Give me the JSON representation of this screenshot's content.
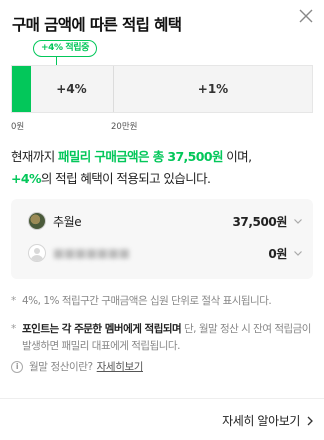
{
  "header": {
    "title": "구매 금액에 따른 적립 혜택",
    "close_icon": "close-icon"
  },
  "tier": {
    "badge": "+4% 적립중",
    "segments": [
      "+4%",
      "+1%"
    ],
    "ticks": [
      "0원",
      "20만원"
    ],
    "current_amount": 37500,
    "threshold_amount": 200000,
    "accent_color": "#03c75a"
  },
  "summary": {
    "part1": "현재까지 ",
    "highlight1": "패밀리 구매금액은 총 37,500원",
    "part2": " 이며,",
    "highlight2": "+4%",
    "part3": "의 적립 혜택이 적용되고 있습니다."
  },
  "members": [
    {
      "name": "추월e",
      "amount": "37,500원",
      "avatar_icon": "user-photo-avatar",
      "chevron_icon": "chevron-down-icon"
    },
    {
      "name": "",
      "amount": "0원",
      "avatar_icon": "default-user-avatar-icon",
      "chevron_icon": "chevron-down-icon"
    }
  ],
  "notes": {
    "note1": "4%, 1% 적립구간 구매금액은 십원 단위로 절삭 표시됩니다.",
    "note2_strong": "포인트는 각 주문한 멤버에게 적립되며",
    "note2_rest": " 단, 월말 정산 시 잔여 적립금이 발생하면 패밀리 대표에게 적립됩니다.",
    "info_question": "월말 정산이란?",
    "info_link": "자세히보기",
    "info_icon": "info-icon"
  },
  "footer": {
    "more_label": "자세히 알아보기",
    "more_icon": "chevron-right-icon"
  }
}
